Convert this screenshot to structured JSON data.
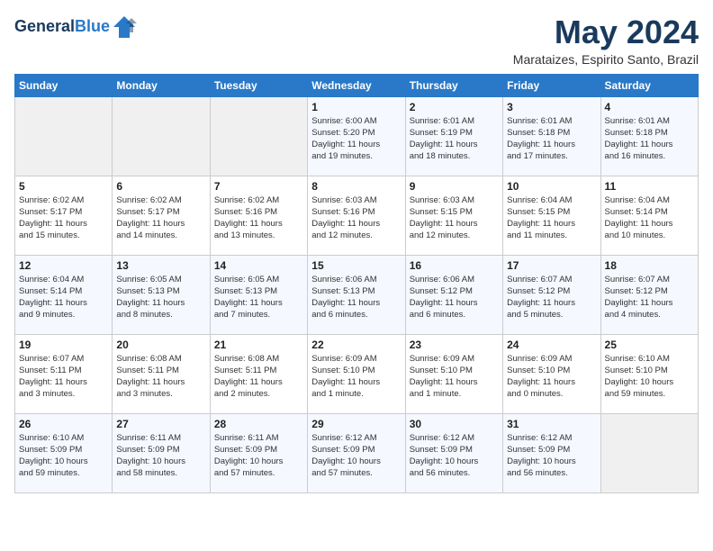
{
  "header": {
    "logo_line1": "General",
    "logo_line2": "Blue",
    "month_title": "May 2024",
    "location": "Marataizes, Espirito Santo, Brazil"
  },
  "weekdays": [
    "Sunday",
    "Monday",
    "Tuesday",
    "Wednesday",
    "Thursday",
    "Friday",
    "Saturday"
  ],
  "weeks": [
    [
      {
        "day": "",
        "info": ""
      },
      {
        "day": "",
        "info": ""
      },
      {
        "day": "",
        "info": ""
      },
      {
        "day": "1",
        "info": "Sunrise: 6:00 AM\nSunset: 5:20 PM\nDaylight: 11 hours\nand 19 minutes."
      },
      {
        "day": "2",
        "info": "Sunrise: 6:01 AM\nSunset: 5:19 PM\nDaylight: 11 hours\nand 18 minutes."
      },
      {
        "day": "3",
        "info": "Sunrise: 6:01 AM\nSunset: 5:18 PM\nDaylight: 11 hours\nand 17 minutes."
      },
      {
        "day": "4",
        "info": "Sunrise: 6:01 AM\nSunset: 5:18 PM\nDaylight: 11 hours\nand 16 minutes."
      }
    ],
    [
      {
        "day": "5",
        "info": "Sunrise: 6:02 AM\nSunset: 5:17 PM\nDaylight: 11 hours\nand 15 minutes."
      },
      {
        "day": "6",
        "info": "Sunrise: 6:02 AM\nSunset: 5:17 PM\nDaylight: 11 hours\nand 14 minutes."
      },
      {
        "day": "7",
        "info": "Sunrise: 6:02 AM\nSunset: 5:16 PM\nDaylight: 11 hours\nand 13 minutes."
      },
      {
        "day": "8",
        "info": "Sunrise: 6:03 AM\nSunset: 5:16 PM\nDaylight: 11 hours\nand 12 minutes."
      },
      {
        "day": "9",
        "info": "Sunrise: 6:03 AM\nSunset: 5:15 PM\nDaylight: 11 hours\nand 12 minutes."
      },
      {
        "day": "10",
        "info": "Sunrise: 6:04 AM\nSunset: 5:15 PM\nDaylight: 11 hours\nand 11 minutes."
      },
      {
        "day": "11",
        "info": "Sunrise: 6:04 AM\nSunset: 5:14 PM\nDaylight: 11 hours\nand 10 minutes."
      }
    ],
    [
      {
        "day": "12",
        "info": "Sunrise: 6:04 AM\nSunset: 5:14 PM\nDaylight: 11 hours\nand 9 minutes."
      },
      {
        "day": "13",
        "info": "Sunrise: 6:05 AM\nSunset: 5:13 PM\nDaylight: 11 hours\nand 8 minutes."
      },
      {
        "day": "14",
        "info": "Sunrise: 6:05 AM\nSunset: 5:13 PM\nDaylight: 11 hours\nand 7 minutes."
      },
      {
        "day": "15",
        "info": "Sunrise: 6:06 AM\nSunset: 5:13 PM\nDaylight: 11 hours\nand 6 minutes."
      },
      {
        "day": "16",
        "info": "Sunrise: 6:06 AM\nSunset: 5:12 PM\nDaylight: 11 hours\nand 6 minutes."
      },
      {
        "day": "17",
        "info": "Sunrise: 6:07 AM\nSunset: 5:12 PM\nDaylight: 11 hours\nand 5 minutes."
      },
      {
        "day": "18",
        "info": "Sunrise: 6:07 AM\nSunset: 5:12 PM\nDaylight: 11 hours\nand 4 minutes."
      }
    ],
    [
      {
        "day": "19",
        "info": "Sunrise: 6:07 AM\nSunset: 5:11 PM\nDaylight: 11 hours\nand 3 minutes."
      },
      {
        "day": "20",
        "info": "Sunrise: 6:08 AM\nSunset: 5:11 PM\nDaylight: 11 hours\nand 3 minutes."
      },
      {
        "day": "21",
        "info": "Sunrise: 6:08 AM\nSunset: 5:11 PM\nDaylight: 11 hours\nand 2 minutes."
      },
      {
        "day": "22",
        "info": "Sunrise: 6:09 AM\nSunset: 5:10 PM\nDaylight: 11 hours\nand 1 minute."
      },
      {
        "day": "23",
        "info": "Sunrise: 6:09 AM\nSunset: 5:10 PM\nDaylight: 11 hours\nand 1 minute."
      },
      {
        "day": "24",
        "info": "Sunrise: 6:09 AM\nSunset: 5:10 PM\nDaylight: 11 hours\nand 0 minutes."
      },
      {
        "day": "25",
        "info": "Sunrise: 6:10 AM\nSunset: 5:10 PM\nDaylight: 10 hours\nand 59 minutes."
      }
    ],
    [
      {
        "day": "26",
        "info": "Sunrise: 6:10 AM\nSunset: 5:09 PM\nDaylight: 10 hours\nand 59 minutes."
      },
      {
        "day": "27",
        "info": "Sunrise: 6:11 AM\nSunset: 5:09 PM\nDaylight: 10 hours\nand 58 minutes."
      },
      {
        "day": "28",
        "info": "Sunrise: 6:11 AM\nSunset: 5:09 PM\nDaylight: 10 hours\nand 57 minutes."
      },
      {
        "day": "29",
        "info": "Sunrise: 6:12 AM\nSunset: 5:09 PM\nDaylight: 10 hours\nand 57 minutes."
      },
      {
        "day": "30",
        "info": "Sunrise: 6:12 AM\nSunset: 5:09 PM\nDaylight: 10 hours\nand 56 minutes."
      },
      {
        "day": "31",
        "info": "Sunrise: 6:12 AM\nSunset: 5:09 PM\nDaylight: 10 hours\nand 56 minutes."
      },
      {
        "day": "",
        "info": ""
      }
    ]
  ]
}
